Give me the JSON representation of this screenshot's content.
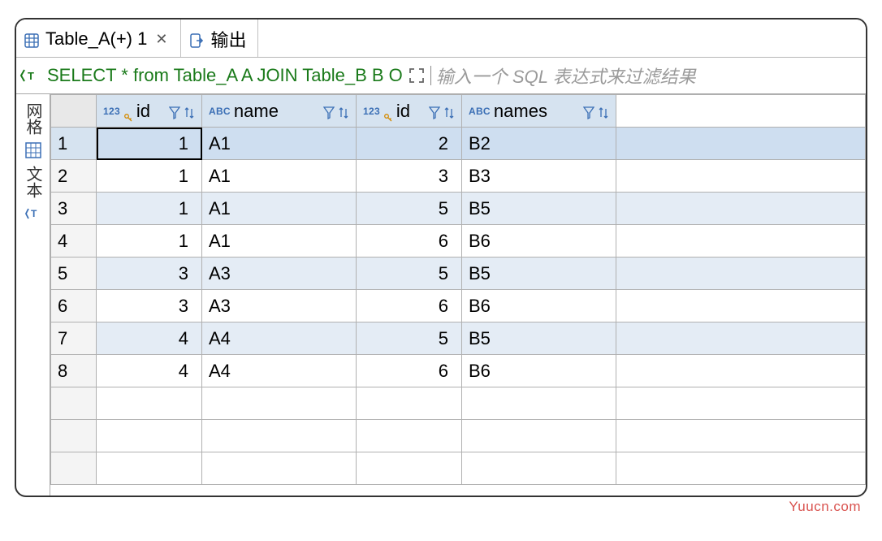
{
  "tabs": [
    {
      "label": "Table_A(+) 1",
      "active": true,
      "closable": true
    },
    {
      "label": "输出",
      "active": false,
      "closable": false
    }
  ],
  "sql_preview": "SELECT * from Table_A A JOIN Table_B B O",
  "sql_filter_placeholder": "输入一个 SQL 表达式来过滤结果",
  "sidebar": {
    "grid_label": "网格",
    "text_label": "文本"
  },
  "columns": [
    {
      "type": "123",
      "name": "id",
      "key": true
    },
    {
      "type": "ABC",
      "name": "name",
      "key": false
    },
    {
      "type": "123",
      "name": "id",
      "key": true
    },
    {
      "type": "ABC",
      "name": "names",
      "key": false
    }
  ],
  "rows": [
    {
      "n": "1",
      "c": [
        "1",
        "A1",
        "2",
        "B2"
      ]
    },
    {
      "n": "2",
      "c": [
        "1",
        "A1",
        "3",
        "B3"
      ]
    },
    {
      "n": "3",
      "c": [
        "1",
        "A1",
        "5",
        "B5"
      ]
    },
    {
      "n": "4",
      "c": [
        "1",
        "A1",
        "6",
        "B6"
      ]
    },
    {
      "n": "5",
      "c": [
        "3",
        "A3",
        "5",
        "B5"
      ]
    },
    {
      "n": "6",
      "c": [
        "3",
        "A3",
        "6",
        "B6"
      ]
    },
    {
      "n": "7",
      "c": [
        "4",
        "A4",
        "5",
        "B5"
      ]
    },
    {
      "n": "8",
      "c": [
        "4",
        "A4",
        "6",
        "B6"
      ]
    }
  ],
  "empty_rows": 3,
  "watermark": "Yuucn.com"
}
